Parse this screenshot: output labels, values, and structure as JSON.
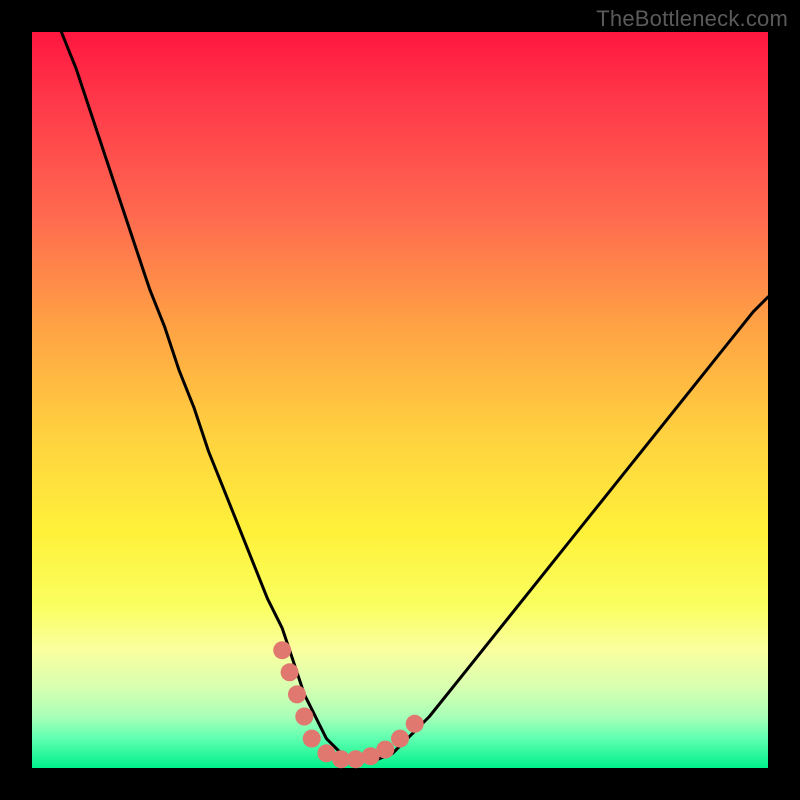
{
  "watermark": "TheBottleneck.com",
  "colors": {
    "frame": "#000000",
    "curve": "#000000",
    "highlight": "#e07870",
    "gradient_top": "#ff173f",
    "gradient_bottom": "#00f08a"
  },
  "chart_data": {
    "type": "line",
    "title": "",
    "xlabel": "",
    "ylabel": "",
    "xlim": [
      0,
      100
    ],
    "ylim": [
      0,
      100
    ],
    "grid": false,
    "legend": false,
    "series": [
      {
        "name": "curve",
        "x": [
          4,
          6,
          8,
          10,
          12,
          14,
          16,
          18,
          20,
          22,
          24,
          26,
          28,
          30,
          32,
          34,
          35,
          36,
          37,
          38,
          39,
          40,
          41,
          42,
          43,
          44,
          45,
          47,
          49,
          51,
          54,
          58,
          62,
          66,
          70,
          74,
          78,
          82,
          86,
          90,
          94,
          98,
          100
        ],
        "values": [
          100,
          95,
          89,
          83,
          77,
          71,
          65,
          60,
          54,
          49,
          43,
          38,
          33,
          28,
          23,
          19,
          16,
          13,
          10,
          8,
          6,
          4,
          3,
          2,
          1.5,
          1.2,
          1.0,
          1.2,
          2,
          4,
          7,
          12,
          17,
          22,
          27,
          32,
          37,
          42,
          47,
          52,
          57,
          62,
          64
        ]
      }
    ],
    "highlight_dots": {
      "name": "bottom-dots",
      "x": [
        34,
        35,
        36,
        37,
        38,
        40,
        42,
        44,
        46,
        48,
        50,
        52
      ],
      "values": [
        16,
        13,
        10,
        7,
        4,
        2,
        1.2,
        1.2,
        1.6,
        2.5,
        4,
        6
      ]
    }
  }
}
